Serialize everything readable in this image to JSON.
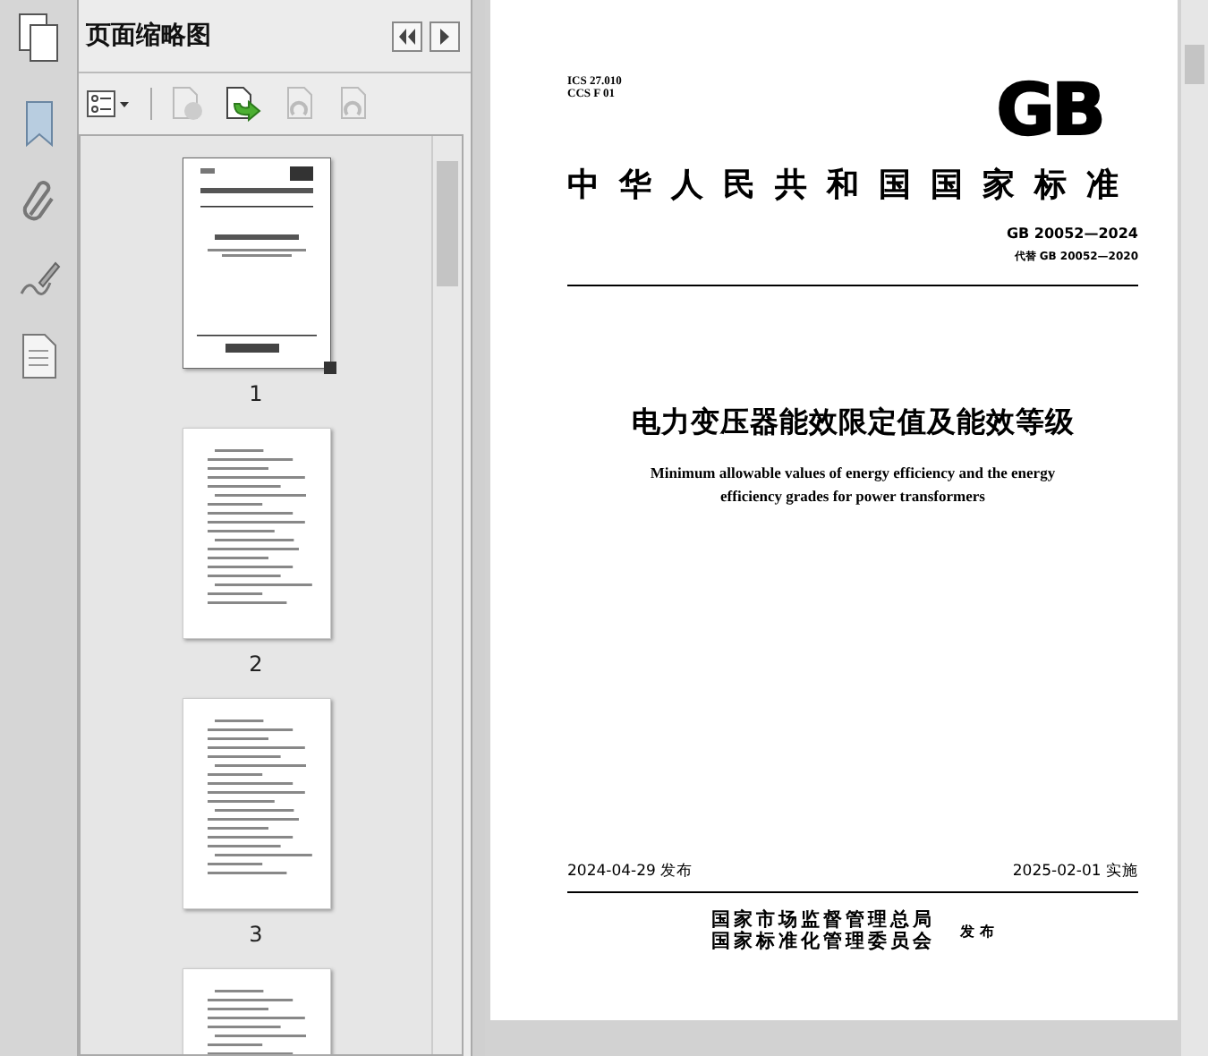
{
  "panel": {
    "title": "页面缩略图",
    "thumbnails": [
      {
        "label": "1",
        "selected": true,
        "kind": "cover"
      },
      {
        "label": "2",
        "selected": false,
        "kind": "text"
      },
      {
        "label": "3",
        "selected": false,
        "kind": "text"
      },
      {
        "selected": false,
        "kind": "text"
      }
    ]
  },
  "document": {
    "ics": "ICS 27.010",
    "ccs": "CCS F 01",
    "logo": "GB",
    "standard_title": "中华人民共和国国家标准",
    "code": "GB 20052—2024",
    "replaces": "代替 GB 20052—2020",
    "title": "电力变压器能效限定值及能效等级",
    "english_title": [
      "Minimum allowable values of energy efficiency and the energy",
      "efficiency grades for power transformers"
    ],
    "issue_date": "2024-04-29 发布",
    "effective_date": "2025-02-01 实施",
    "issuers": [
      "国家市场监督管理总局",
      "国家标准化管理委员会"
    ],
    "issued": "发 布"
  }
}
